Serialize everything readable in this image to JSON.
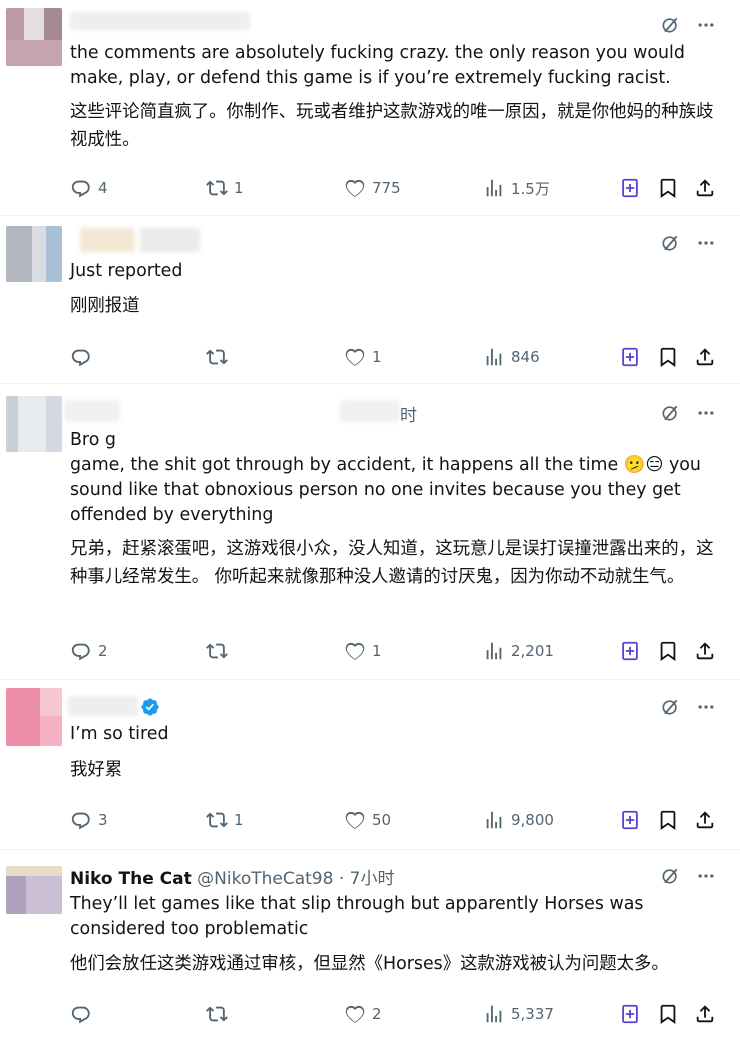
{
  "colors": {
    "text": "#0f1419",
    "muted": "#536471",
    "accent_purple": "#5b3fd6",
    "verified": "#1d9bf0"
  },
  "tweets": [
    {
      "author_name": "",
      "author_handle": "",
      "time": "",
      "text_en": "the comments are absolutely fucking crazy. the only reason you would make, play, or defend this game is if you’re extremely fucking racist.",
      "text_zh": "这些评论简直疯了。你制作、玩或者维护这款游戏的唯一原因，就是你他妈的种族歧视成性。",
      "replies": "4",
      "retweets": "1",
      "likes": "775",
      "views": "1.5万"
    },
    {
      "author_name": "",
      "author_handle": "",
      "time": "",
      "text_en": "Just reported",
      "text_zh": "刚刚报道",
      "replies": "",
      "retweets": "",
      "likes": "1",
      "views": "846"
    },
    {
      "author_name": "",
      "author_handle": "",
      "time": "时",
      "text_en_partial": "Bro g",
      "text_en": "game, the shit got through by accident, it happens all the time 🫤😑 you sound like that obnoxious person no one invites because you they get offended by everything",
      "text_zh": "兄弟，赶紧滚蛋吧，这游戏很小众，没人知道，这玩意儿是误打误撞泄露出来的，这种事儿经常发生。 你听起来就像那种没人邀请的讨厌鬼，因为你动不动就生气。",
      "replies": "2",
      "retweets": "",
      "likes": "1",
      "views": "2,201"
    },
    {
      "author_name": "",
      "author_handle": "",
      "time": "",
      "text_en": "I’m so tired",
      "text_zh": "我好累",
      "replies": "3",
      "retweets": "1",
      "likes": "50",
      "views": "9,800"
    },
    {
      "author_name": "Niko The Cat",
      "author_handle": "@NikoTheCat98",
      "time": "· 7小时",
      "text_en": "They’ll let games like that slip through but apparently Horses was considered too problematic",
      "text_zh": "他们会放任这类游戏通过审核，但显然《Horses》这款游戏被认为问题太多。",
      "replies": "",
      "retweets": "",
      "likes": "2",
      "views": "5,337"
    }
  ],
  "icons": [
    "reply-icon",
    "retweet-icon",
    "like-icon",
    "views-icon",
    "grok-icon",
    "bookmark-icon",
    "share-icon",
    "more-icon",
    "verified-icon"
  ]
}
